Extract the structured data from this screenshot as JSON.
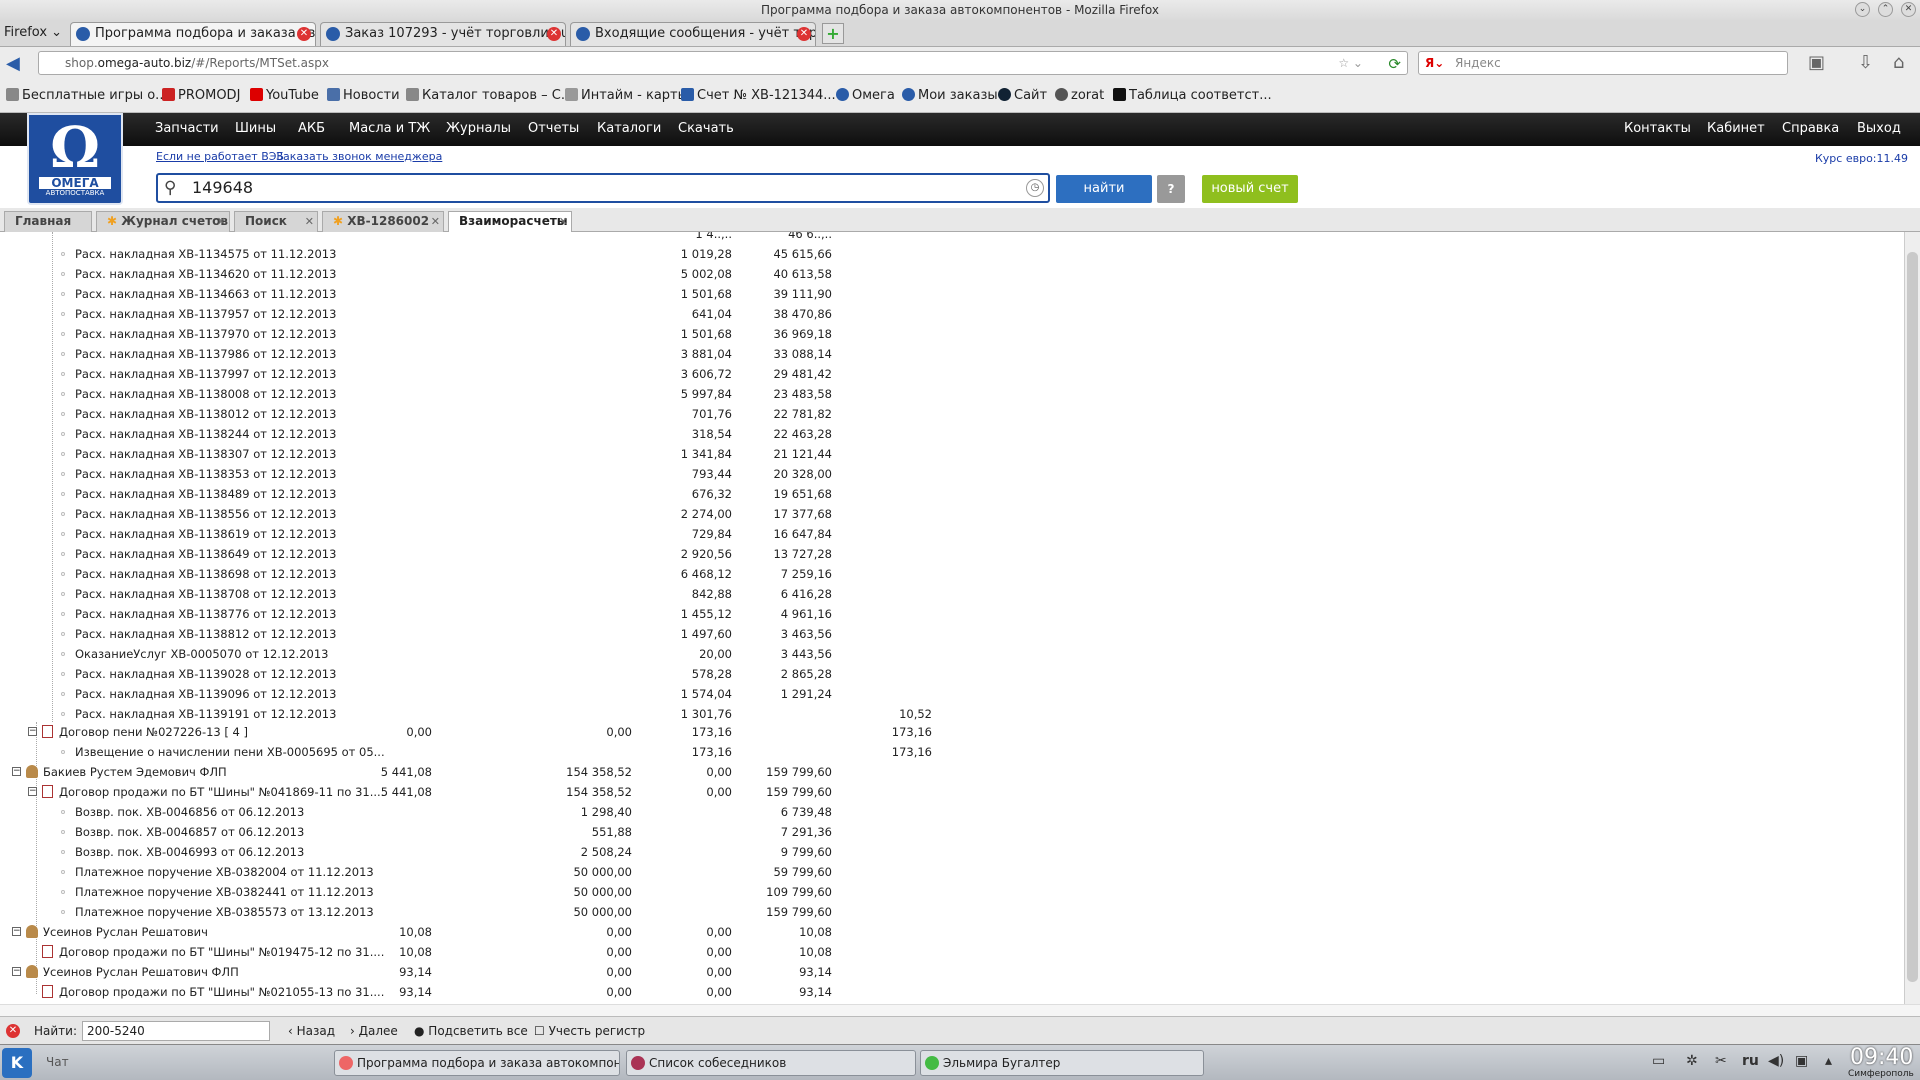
{
  "window": {
    "title": "Программа подбора и заказа автокомпонентов - Mozilla Firefox"
  },
  "browser": {
    "menu_label": "Firefox",
    "tabs": [
      {
        "label": "Программа подбора и заказа авт..."
      },
      {
        "label": "Заказ 107293 - учёт торговли aut..."
      },
      {
        "label": "Входящие сообщения - учёт тор..."
      }
    ],
    "url_prefix": "shop.",
    "url_domain": "omega-auto.biz",
    "url_path": "/#/Reports/MTSet.aspx",
    "search_placeholder": "Яндекс",
    "bookmarks": [
      "Бесплатные игры о...",
      "PROMODJ",
      "YouTube",
      "Новости",
      "Каталог товаров – С...",
      "Интайм - карты",
      "Счет № ХВ-121344...",
      "Омега",
      "Мои заказы",
      "Сайт",
      "zorat",
      "Таблица соответст..."
    ]
  },
  "site": {
    "logo_text": "ОМЕГА",
    "logo_sub": "АВТОПОСТАВКА",
    "nav_left": [
      "Запчасти",
      "Шины",
      "АКБ",
      "Масла и ТЖ",
      "Журналы",
      "Отчеты",
      "Каталоги",
      "Скачать"
    ],
    "nav_right": [
      "Контакты",
      "Кабинет",
      "Справка",
      "Выход"
    ],
    "link_vzb": "Если не работает ВЭБ",
    "link_call": "Заказать звонок менеджера",
    "kurs": "Курс евро:11.49",
    "search_value": "149648",
    "find_label": "найти",
    "help_label": "?",
    "new_invoice_label": "новый счет"
  },
  "app_tabs": [
    "Главная",
    "Журнал счетов",
    "Поиск",
    "ХВ-1286002",
    "Взаиморасчеты"
  ],
  "report_rows": [
    {
      "label": "Расх. накладная ХВ-1134575 от 11.12.2013",
      "c3": "1 019,28",
      "c4": "45 615,66",
      "c5": ""
    },
    {
      "label": "Расх. накладная ХВ-1134620 от 11.12.2013",
      "c3": "5 002,08",
      "c4": "40 613,58",
      "c5": ""
    },
    {
      "label": "Расх. накладная ХВ-1134663 от 11.12.2013",
      "c3": "1 501,68",
      "c4": "39 111,90",
      "c5": ""
    },
    {
      "label": "Расх. накладная ХВ-1137957 от 12.12.2013",
      "c3": "641,04",
      "c4": "38 470,86",
      "c5": ""
    },
    {
      "label": "Расх. накладная ХВ-1137970 от 12.12.2013",
      "c3": "1 501,68",
      "c4": "36 969,18",
      "c5": ""
    },
    {
      "label": "Расх. накладная ХВ-1137986 от 12.12.2013",
      "c3": "3 881,04",
      "c4": "33 088,14",
      "c5": ""
    },
    {
      "label": "Расх. накладная ХВ-1137997 от 12.12.2013",
      "c3": "3 606,72",
      "c4": "29 481,42",
      "c5": ""
    },
    {
      "label": "Расх. накладная ХВ-1138008 от 12.12.2013",
      "c3": "5 997,84",
      "c4": "23 483,58",
      "c5": ""
    },
    {
      "label": "Расх. накладная ХВ-1138012 от 12.12.2013",
      "c3": "701,76",
      "c4": "22 781,82",
      "c5": ""
    },
    {
      "label": "Расх. накладная ХВ-1138244 от 12.12.2013",
      "c3": "318,54",
      "c4": "22 463,28",
      "c5": ""
    },
    {
      "label": "Расх. накладная ХВ-1138307 от 12.12.2013",
      "c3": "1 341,84",
      "c4": "21 121,44",
      "c5": ""
    },
    {
      "label": "Расх. накладная ХВ-1138353 от 12.12.2013",
      "c3": "793,44",
      "c4": "20 328,00",
      "c5": ""
    },
    {
      "label": "Расх. накладная ХВ-1138489 от 12.12.2013",
      "c3": "676,32",
      "c4": "19 651,68",
      "c5": ""
    },
    {
      "label": "Расх. накладная ХВ-1138556 от 12.12.2013",
      "c3": "2 274,00",
      "c4": "17 377,68",
      "c5": ""
    },
    {
      "label": "Расх. накладная ХВ-1138619 от 12.12.2013",
      "c3": "729,84",
      "c4": "16 647,84",
      "c5": ""
    },
    {
      "label": "Расх. накладная ХВ-1138649 от 12.12.2013",
      "c3": "2 920,56",
      "c4": "13 727,28",
      "c5": ""
    },
    {
      "label": "Расх. накладная ХВ-1138698 от 12.12.2013",
      "c3": "6 468,12",
      "c4": "7 259,16",
      "c5": ""
    },
    {
      "label": "Расх. накладная ХВ-1138708 от 12.12.2013",
      "c3": "842,88",
      "c4": "6 416,28",
      "c5": ""
    },
    {
      "label": "Расх. накладная ХВ-1138776 от 12.12.2013",
      "c3": "1 455,12",
      "c4": "4 961,16",
      "c5": ""
    },
    {
      "label": "Расх. накладная ХВ-1138812 от 12.12.2013",
      "c3": "1 497,60",
      "c4": "3 463,56",
      "c5": ""
    },
    {
      "label": "ОказаниеУслуг ХВ-0005070 от 12.12.2013",
      "c3": "20,00",
      "c4": "3 443,56",
      "c5": ""
    },
    {
      "label": "Расх. накладная ХВ-1139028 от 12.12.2013",
      "c3": "578,28",
      "c4": "2 865,28",
      "c5": ""
    },
    {
      "label": "Расх. накладная ХВ-1139096 от 12.12.2013",
      "c3": "1 574,04",
      "c4": "1 291,24",
      "c5": ""
    },
    {
      "label": "Расх. накладная ХВ-1139191 от 12.12.2013",
      "c3": "1 301,76",
      "c4": "",
      "c5": "10,52"
    }
  ],
  "groups": {
    "dogovor_peni": {
      "label": "Договор пени №027226-13 [ 4 ]",
      "c1": "0,00",
      "c2": "0,00",
      "c3": "173,16",
      "c5": "173,16"
    },
    "izveshchenie": {
      "label": "Извещение о начислении пени ХВ-0005695 от 05...",
      "c3": "173,16",
      "c5": "173,16"
    },
    "bakiev": {
      "label": "Бакиев Рустем Эдемович ФЛП",
      "c1": "5 441,08",
      "c2": "154 358,52",
      "c3": "0,00",
      "c4": "159 799,60"
    },
    "bakiev_dog": {
      "label": "Договор продажи по БТ \"Шины\" №041869-11 по 31....",
      "c1": "5 441,08",
      "c2": "154 358,52",
      "c3": "0,00",
      "c4": "159 799,60"
    },
    "bakiev_items": [
      {
        "label": "Возвр. пок. ХВ-0046856 от 06.12.2013",
        "c2": "1 298,40",
        "c4": "6 739,48"
      },
      {
        "label": "Возвр. пок. ХВ-0046857 от 06.12.2013",
        "c2": "551,88",
        "c4": "7 291,36"
      },
      {
        "label": "Возвр. пок. ХВ-0046993 от 06.12.2013",
        "c2": "2 508,24",
        "c4": "9 799,60"
      },
      {
        "label": "Платежное поручение ХВ-0382004 от 11.12.2013",
        "c2": "50 000,00",
        "c4": "59 799,60"
      },
      {
        "label": "Платежное поручение ХВ-0382441 от 11.12.2013",
        "c2": "50 000,00",
        "c4": "109 799,60"
      },
      {
        "label": "Платежное поручение ХВ-0385573 от 13.12.2013",
        "c2": "50 000,00",
        "c4": "159 799,60"
      }
    ],
    "usein1": {
      "label": "Усеинов Руслан Решатович",
      "c1": "10,08",
      "c2": "0,00",
      "c3": "0,00",
      "c4": "10,08"
    },
    "usein1_dog": {
      "label": "Договор продажи по БТ \"Шины\" №019475-12 по 31....",
      "c1": "10,08",
      "c2": "0,00",
      "c3": "0,00",
      "c4": "10,08"
    },
    "usein2": {
      "label": "Усеинов Руслан Решатович ФЛП",
      "c1": "93,14",
      "c2": "0,00",
      "c3": "0,00",
      "c4": "93,14"
    },
    "usein2_dog": {
      "label": "Договор продажи по БТ \"Шины\" №021055-13 по 31....",
      "c1": "93,14",
      "c2": "0,00",
      "c3": "0,00",
      "c4": "93,14"
    }
  },
  "findbar": {
    "label": "Найти:",
    "value": "200-5240",
    "back": "Назад",
    "next": "Далее",
    "highlight": "Подсветить все",
    "match_case": "Учесть регистр"
  },
  "taskbar": {
    "chat": "Чат",
    "tasks": [
      "Программа подбора и заказа автокомпонент",
      "Список собеседников",
      "Эльмира Бугалтер"
    ],
    "lang": "ru",
    "time": "09:40",
    "city": "Симферополь"
  }
}
